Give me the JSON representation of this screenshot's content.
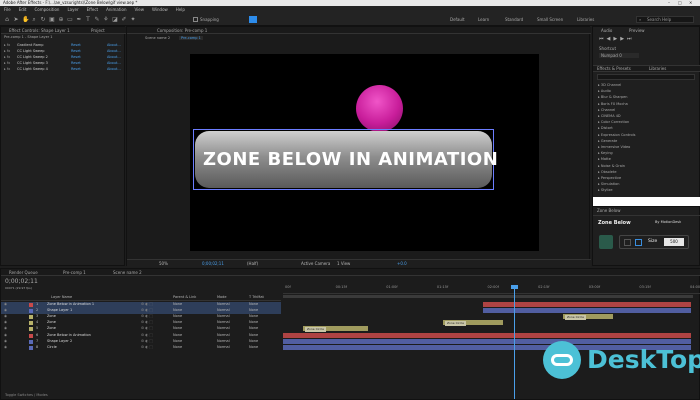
{
  "window": {
    "title": "Adobe After Effects - F:\\...\\ae_vzsurights\\\\Zone Below\\gif view.aep *",
    "controls": [
      "–",
      "□",
      "✕"
    ]
  },
  "menu": [
    "File",
    "Edit",
    "Composition",
    "Layer",
    "Effect",
    "Animation",
    "View",
    "Window",
    "Help"
  ],
  "toolbar": {
    "snapping": "Snapping",
    "workspaces": [
      "Default",
      "Learn",
      "Standard",
      "Small Screen",
      "Libraries"
    ],
    "active_workspace": "Standard",
    "search_placeholder": "Search Help"
  },
  "left_panel": {
    "tabs": [
      "Effect Controls: Shape Layer 1",
      "Project"
    ],
    "breadcrumb": "Pre-comp 1 - Shape Layer 1",
    "effects": [
      {
        "name": "Gradient Ramp",
        "reset": "Reset",
        "about": "About..."
      },
      {
        "name": "CC Light Sweep",
        "reset": "Reset",
        "about": "About..."
      },
      {
        "name": "CC Light Sweep 2",
        "reset": "Reset",
        "about": "About..."
      },
      {
        "name": "CC Light Sweep 3",
        "reset": "Reset",
        "about": "About..."
      },
      {
        "name": "CC Light Sweep 4",
        "reset": "Reset",
        "about": "About..."
      }
    ]
  },
  "composition": {
    "tab": "Composition: Pre-comp 1",
    "breadcrumbs": [
      "Scene name 2",
      "Pre-comp 1"
    ],
    "canvas_text": "ZONE BELOW IN ANIMATION",
    "footer": {
      "zoom": "50%",
      "timecode": "0;00;02;11",
      "resolution": "(Half)",
      "camera": "Active Camera",
      "view": "1 View",
      "exposure": "+0.0"
    }
  },
  "right_panel": {
    "top_tabs": [
      "Audio",
      "Preview"
    ],
    "shortcut_label": "Shortcut",
    "shortcut_value": "Numpad 0",
    "effects_tabs": [
      "Effects & Presets",
      "Libraries"
    ],
    "effects_list": [
      "3D Channel",
      "Audio",
      "Blur & Sharpen",
      "Boris FX Mocha",
      "Channel",
      "CINEMA 4D",
      "Color Correction",
      "Distort",
      "Expression Controls",
      "Generate",
      "Immersive Video",
      "Keying",
      "Matte",
      "Noise & Grain",
      "Obsolete",
      "Perspective",
      "Simulation",
      "Stylize"
    ],
    "plugin": {
      "panel_title": "Zone Below",
      "name": "Zone Below",
      "by": "By MotionDesk",
      "size_label": "Size",
      "size_value": "500"
    }
  },
  "timeline": {
    "tabs": [
      "Render Queue",
      "Pre-comp 1",
      "Scene name 2"
    ],
    "timecode": "0;00;02;11",
    "fps_note": "00071 (29.97 fps)",
    "columns": [
      "Layer Name",
      "Parent & Link",
      "Mode",
      "T TrkMat"
    ],
    "ruler": [
      "00f",
      "00:15f",
      "01:00f",
      "01:15f",
      "02:00f",
      "02:15f",
      "03:00f",
      "03:15f",
      "04:00f"
    ],
    "layers": [
      {
        "num": "1",
        "name": "Zone Below in Animation 1",
        "parent": "None",
        "mode": "Normal",
        "trk": "None",
        "color": "#c84a4a"
      },
      {
        "num": "2",
        "name": "Shape Layer 1",
        "parent": "None",
        "mode": "Normal",
        "trk": "None",
        "color": "#5a6ab8"
      },
      {
        "num": "3",
        "name": "Zone",
        "parent": "None",
        "mode": "Normal",
        "trk": "None",
        "color": "#b8b26a"
      },
      {
        "num": "4",
        "name": "Zone",
        "parent": "None",
        "mode": "Normal",
        "trk": "None",
        "color": "#b8b26a"
      },
      {
        "num": "5",
        "name": "Zone",
        "parent": "None",
        "mode": "Normal",
        "trk": "None",
        "color": "#b8b26a"
      },
      {
        "num": "6",
        "name": "Zone Below in Animation",
        "parent": "None",
        "mode": "Normal",
        "trk": "None",
        "color": "#c84a4a"
      },
      {
        "num": "7",
        "name": "Shape Layer 2",
        "parent": "None",
        "mode": "Normal",
        "trk": "None",
        "color": "#5a6ab8"
      },
      {
        "num": "8",
        "name": "Circle",
        "parent": "None",
        "mode": "Normal",
        "trk": "None",
        "color": "#5a6ab8"
      }
    ],
    "clip_labels": [
      "Zone Circle",
      "Zone Circle",
      "Zone Circle"
    ],
    "toggle": "Toggle Switches / Modes"
  },
  "watermark": {
    "text": "DeskTop",
    "color": "#4cc1d6"
  }
}
